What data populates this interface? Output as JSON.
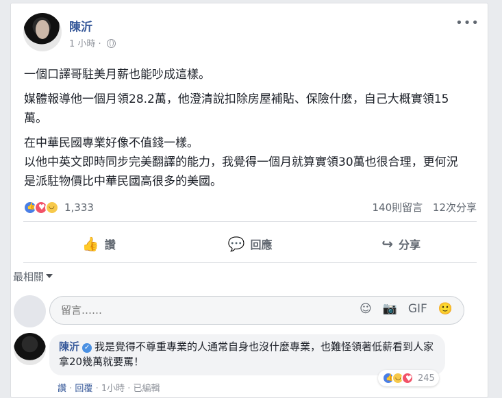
{
  "post": {
    "author": "陳沂",
    "time": "1 小時",
    "more_label": "•••",
    "paragraphs": [
      "一個口譯哥駐美月薪也能吵成這樣。",
      "媒體報導他一個月領28.2萬，他澄清說扣除房屋補貼、保險什麼，自己大概實領15萬。",
      "在中華民國專業好像不值錢一樣。",
      "以他中英文即時同步完美翻譯的能力，我覺得一個月就算實領30萬也很合理，更何況是派駐物價比中華民國高很多的美國。"
    ],
    "reactions_count": "1,333",
    "comments_count": "140則留言",
    "shares_count": "12次分享"
  },
  "actions": {
    "like": "讚",
    "comment": "回應",
    "share": "分享"
  },
  "sort": {
    "label": "最相關"
  },
  "comment_input": {
    "placeholder": "留言……"
  },
  "comment": {
    "author": "陳沂",
    "text": "我是覺得不尊重專業的人通常自身也沒什麼專業，也難怪領著低薪看到人家拿20幾萬就要罵！",
    "reactions_count": "245",
    "like": "讚",
    "reply": "回覆",
    "time": "1小時",
    "edited": "已編輯"
  },
  "colors": {
    "link": "#365899",
    "like": "#4a7fe6",
    "love": "#f25268",
    "haha": "#f7c94b"
  }
}
